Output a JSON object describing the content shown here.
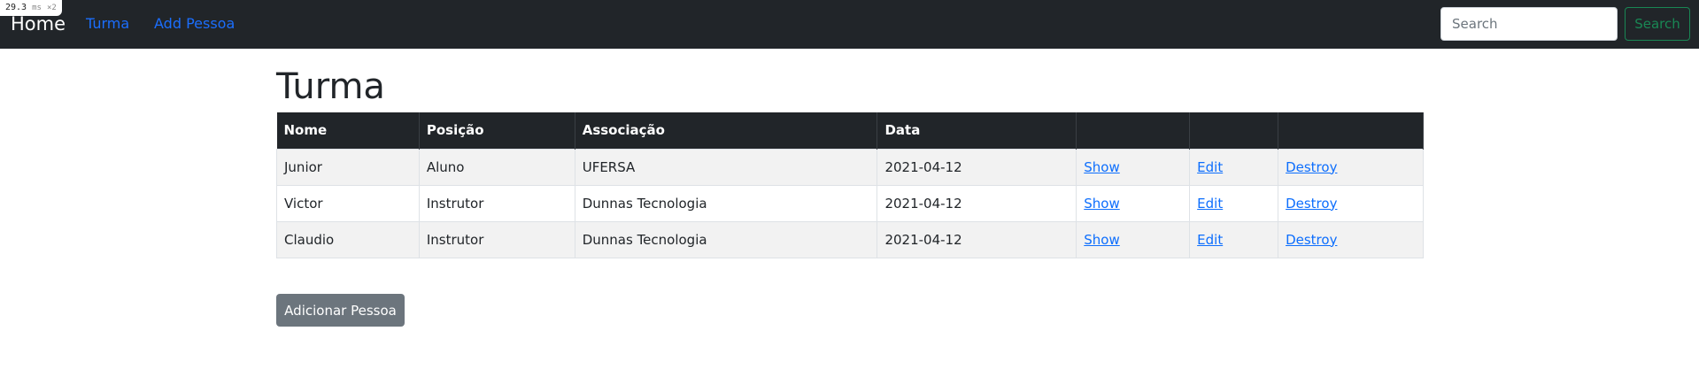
{
  "perf": {
    "value": "29.3",
    "unit": "ms",
    "multiplier": "×2"
  },
  "navbar": {
    "brand": "Home",
    "links": [
      "Turma",
      "Add Pessoa"
    ],
    "search": {
      "placeholder": "Search",
      "value": "",
      "button_label": "Search"
    }
  },
  "page": {
    "title": "Turma"
  },
  "table": {
    "headers": [
      "Nome",
      "Posição",
      "Associação",
      "Data",
      ""
    ],
    "rows": [
      {
        "nome": "Junior",
        "posicao": "Aluno",
        "associacao": "UFERSA",
        "data": "2021-04-12",
        "show": "Show",
        "edit": "Edit",
        "destroy": "Destroy"
      },
      {
        "nome": "Victor",
        "posicao": "Instrutor",
        "associacao": "Dunnas Tecnologia",
        "data": "2021-04-12",
        "show": "Show",
        "edit": "Edit",
        "destroy": "Destroy"
      },
      {
        "nome": "Claudio",
        "posicao": "Instrutor",
        "associacao": "Dunnas Tecnologia",
        "data": "2021-04-12",
        "show": "Show",
        "edit": "Edit",
        "destroy": "Destroy"
      }
    ]
  },
  "actions": {
    "add_label": "Adicionar Pessoa"
  },
  "colors": {
    "navbar_bg": "#212529",
    "nav_link": "#1b6efd",
    "success": "#198754",
    "secondary": "#6c757d",
    "link": "#0d6efd",
    "stripe": "#f2f2f2"
  }
}
